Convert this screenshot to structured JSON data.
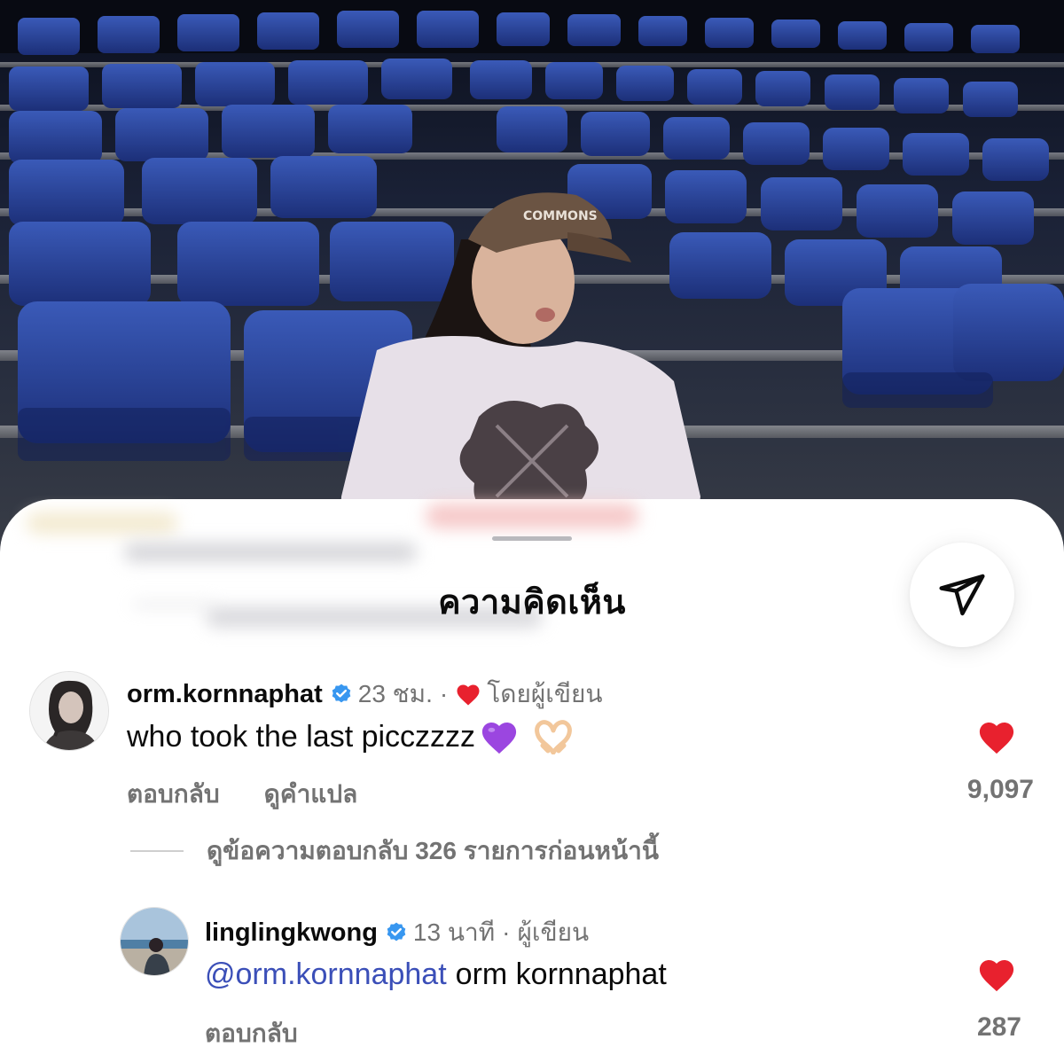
{
  "sheet": {
    "title": "ความคิดเห็น",
    "share_icon": "send-icon"
  },
  "comments": [
    {
      "username": "orm.kornnaphat",
      "verified": true,
      "time": "23 ชม.",
      "author_badge": "โดยผู้เขียน",
      "text": "who took the last picczzzz",
      "emojis": [
        "purple-heart-emoji",
        "heart-hands-emoji"
      ],
      "reply_label": "ตอบกลับ",
      "translate_label": "ดูคำแปล",
      "like_count": "9,097",
      "view_replies": "ดูข้อความตอบกลับ 326 รายการก่อนหน้านี้"
    },
    {
      "username": "linglingkwong",
      "verified": true,
      "time": "13 นาที",
      "author_badge": "ผู้เขียน",
      "mention": "@orm.kornnaphat",
      "text": "orm kornnaphat",
      "reply_label": "ตอบกลับ",
      "like_count": "287"
    }
  ],
  "colors": {
    "heart_red": "#e8212e",
    "verified_blue": "#3897f0",
    "mention_blue": "#3b4fb8",
    "muted_gray": "#737373"
  }
}
